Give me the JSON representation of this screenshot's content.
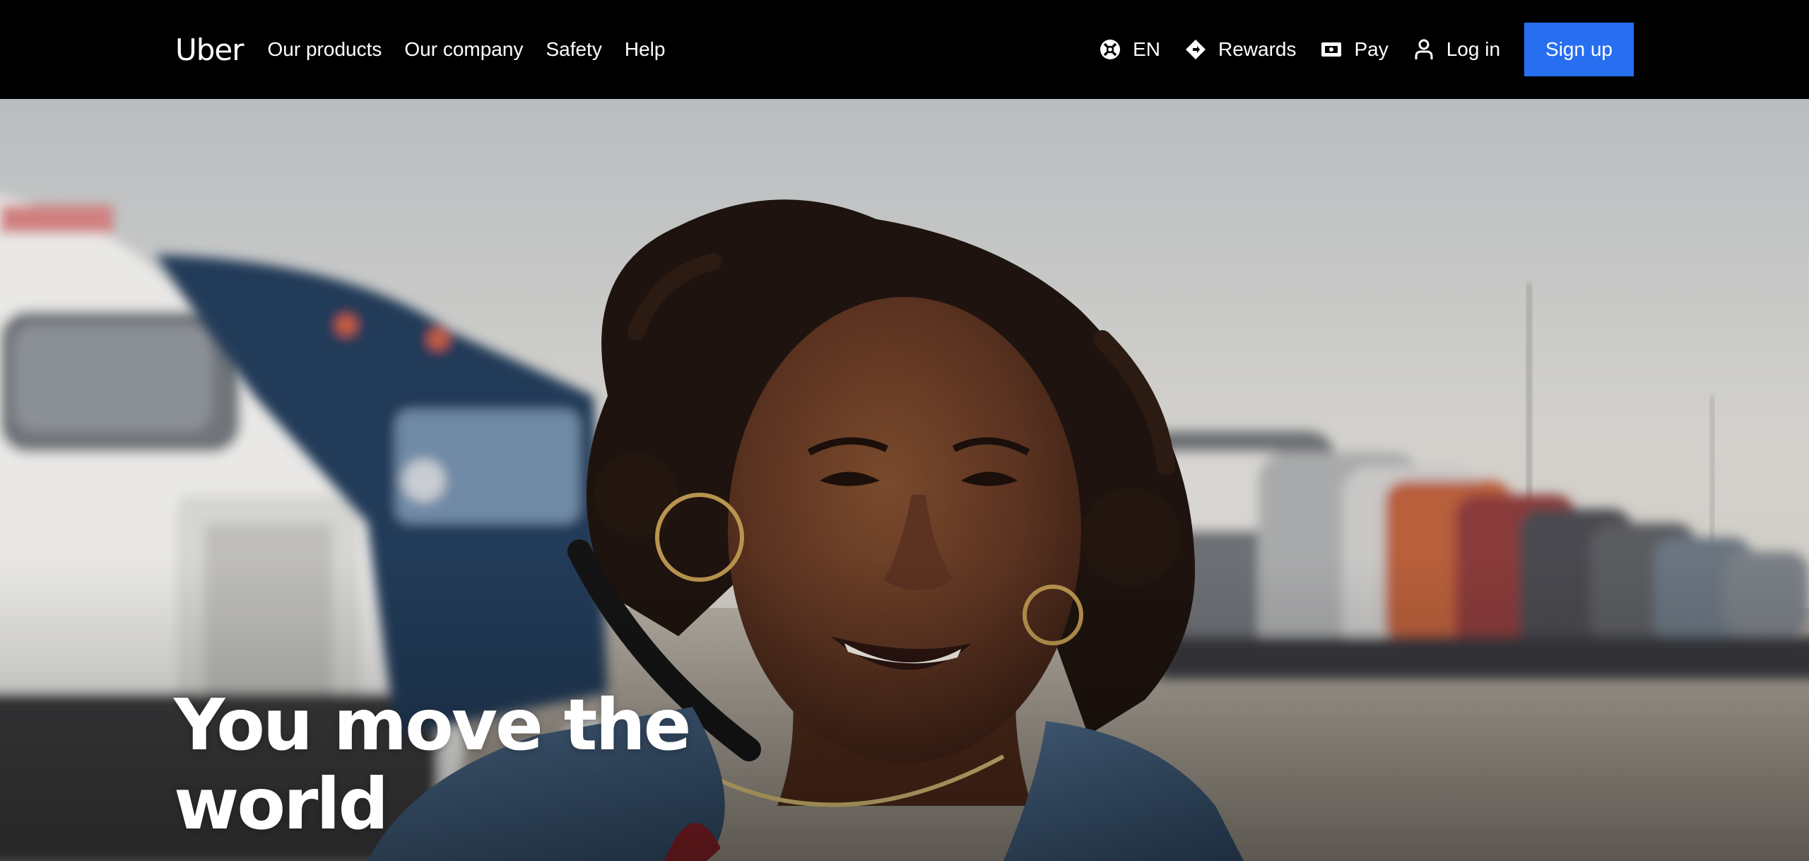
{
  "nav": {
    "logo": "Uber",
    "links": [
      "Our products",
      "Our company",
      "Safety",
      "Help"
    ],
    "language": "EN",
    "rewards": "Rewards",
    "pay": "Pay",
    "login": "Log in",
    "signup": "Sign up",
    "icons": {
      "language": "globe-icon",
      "rewards": "diamond-icon",
      "pay": "wallet-icon",
      "login": "person-icon"
    }
  },
  "hero": {
    "title_line1": "You move the",
    "title_line2": "world",
    "image": "smiling-woman-in-denim-jacket-in-front-of-trucks"
  },
  "colors": {
    "nav_bg": "#000000",
    "signup_bg": "#276ef1",
    "text": "#ffffff"
  }
}
